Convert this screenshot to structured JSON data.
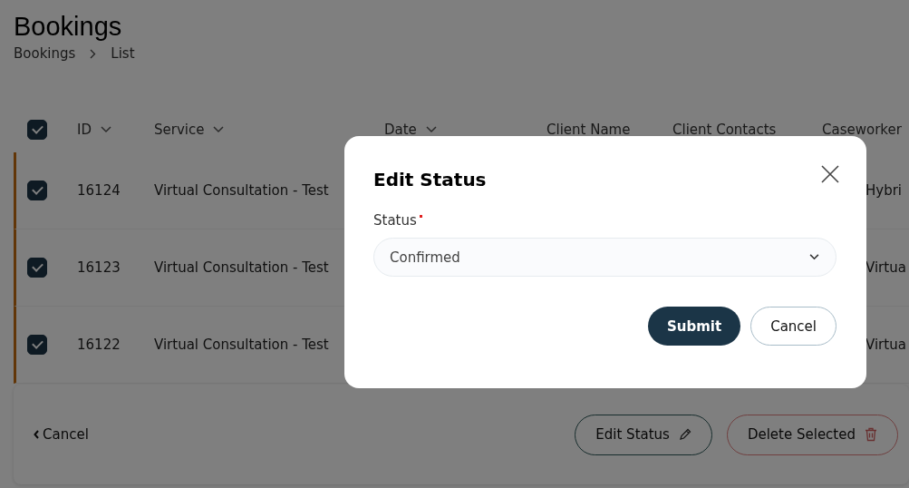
{
  "page": {
    "title": "Bookings",
    "breadcrumb": [
      "Bookings",
      "List"
    ]
  },
  "table": {
    "select_all": {
      "checked": true
    },
    "columns": [
      {
        "label": "ID",
        "sortable": true
      },
      {
        "label": "Service",
        "sortable": true
      },
      {
        "label": "Date",
        "sortable": true
      },
      {
        "label": "Client Name",
        "sortable": false
      },
      {
        "label": "Client Contacts",
        "sortable": false
      },
      {
        "label": "Caseworker"
      }
    ],
    "rows": [
      {
        "checked": true,
        "id": "16124",
        "service": "Virtual Consultation - Test",
        "column_7": "Hybri"
      },
      {
        "checked": true,
        "id": "16123",
        "service": "Virtual Consultation - Test",
        "column_7": "Virtua"
      },
      {
        "checked": true,
        "id": "16122",
        "service": "Virtual Consultation - Test",
        "column_7": "Virtua"
      }
    ]
  },
  "footer": {
    "back": "Cancel",
    "buttons": [
      {
        "kind": "edit",
        "label": "Edit Status"
      },
      {
        "kind": "delete",
        "label": "Delete Selected"
      }
    ]
  },
  "modal": {
    "title": "Edit Status",
    "field_label": "Status",
    "required": true,
    "value": "Confirmed",
    "buttons": [
      {
        "kind": "primary",
        "label": "Submit"
      },
      {
        "kind": "secondary",
        "label": "Cancel"
      }
    ]
  }
}
